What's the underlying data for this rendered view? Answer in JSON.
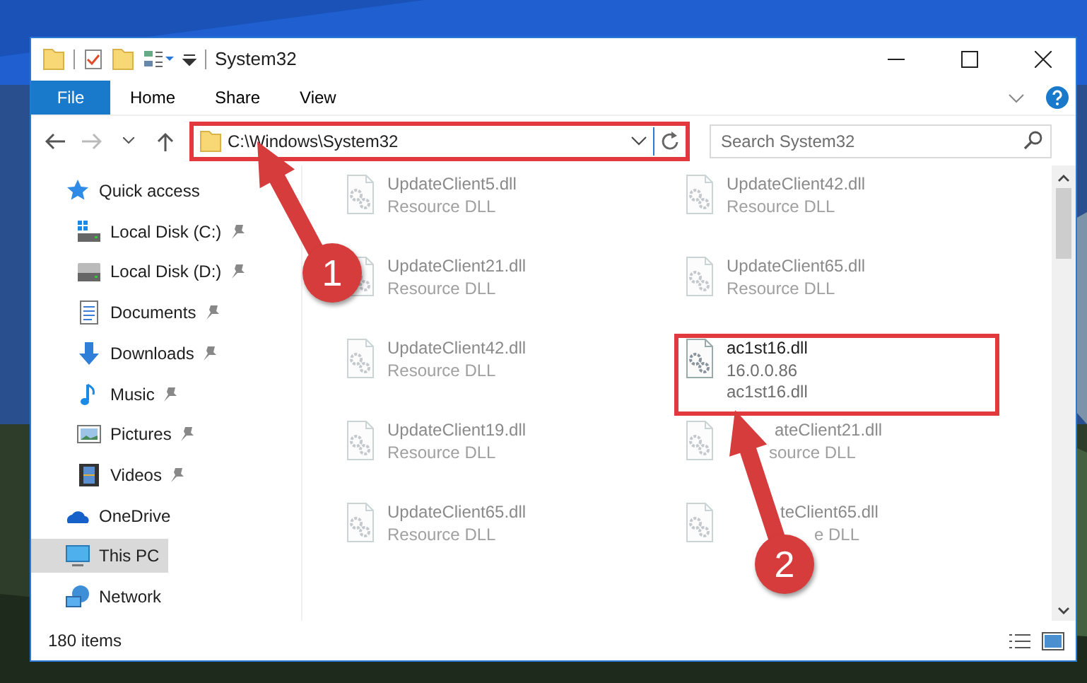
{
  "window": {
    "title": "System32"
  },
  "ribbon": {
    "file_tab": "File",
    "tabs": [
      "Home",
      "Share",
      "View"
    ]
  },
  "address": {
    "path": "C:\\Windows\\System32",
    "highlighted": true
  },
  "search": {
    "placeholder": "Search System32"
  },
  "nav_items": [
    {
      "label": "Quick access",
      "kind": "star",
      "selected": false,
      "children": [
        {
          "label": "Local Disk (C:)",
          "kind": "systemdrive",
          "pinned": true,
          "selected": false
        },
        {
          "label": "Local Disk (D:)",
          "kind": "drive",
          "pinned": true,
          "selected": false
        },
        {
          "label": "Documents",
          "kind": "document",
          "pinned": true,
          "selected": false
        },
        {
          "label": "Downloads",
          "kind": "download",
          "pinned": true,
          "selected": false
        },
        {
          "label": "Music",
          "kind": "music",
          "pinned": true,
          "selected": false
        },
        {
          "label": "Pictures",
          "kind": "pictures",
          "pinned": true,
          "selected": false
        },
        {
          "label": "Videos",
          "kind": "videos",
          "pinned": true,
          "selected": false
        }
      ]
    },
    {
      "label": "OneDrive",
      "kind": "cloud",
      "selected": false
    },
    {
      "label": "This PC",
      "kind": "computer",
      "selected": true
    },
    {
      "label": "Network",
      "kind": "network",
      "selected": false
    }
  ],
  "files": [
    {
      "name": "UpdateClient5.dll",
      "details": [
        "Resource DLL"
      ],
      "faded": true,
      "highlighted": false,
      "kind": "plain"
    },
    {
      "name": "UpdateClient42.dll",
      "details": [
        "Resource DLL"
      ],
      "faded": true,
      "highlighted": false,
      "kind": "plain"
    },
    {
      "name": "UpdateClient21.dll",
      "details": [
        "Resource DLL"
      ],
      "faded": true,
      "highlighted": false,
      "kind": "plain"
    },
    {
      "name": "UpdateClient65.dll",
      "details": [
        "Resource DLL"
      ],
      "faded": true,
      "highlighted": false,
      "kind": "plain"
    },
    {
      "name": "UpdateClient42.dll",
      "details": [
        "Resource DLL"
      ],
      "faded": true,
      "highlighted": false,
      "kind": "plain"
    },
    {
      "name": "ac1st16.dll",
      "details": [
        "16.0.0.86",
        "ac1st16.dll"
      ],
      "faded": false,
      "highlighted": true,
      "kind": "plain"
    },
    {
      "name": "UpdateClient19.dll",
      "details": [
        "Resource DLL"
      ],
      "faded": true,
      "highlighted": false,
      "kind": "plain"
    },
    {
      "name": "ateClient21.dll",
      "details": [
        "source DLL"
      ],
      "faded": true,
      "highlighted": false,
      "kind": "arrowcovered"
    },
    {
      "name": "UpdateClient65.dll",
      "details": [
        "Resource DLL"
      ],
      "faded": true,
      "highlighted": false,
      "kind": "plain"
    },
    {
      "name": "teClient65.dll",
      "details": [
        "e DLL"
      ],
      "faded": true,
      "highlighted": false,
      "kind": "badgecovered"
    }
  ],
  "callouts": [
    {
      "label": "1"
    },
    {
      "label": "2"
    }
  ],
  "status_bar": {
    "item_count": "180 items"
  }
}
